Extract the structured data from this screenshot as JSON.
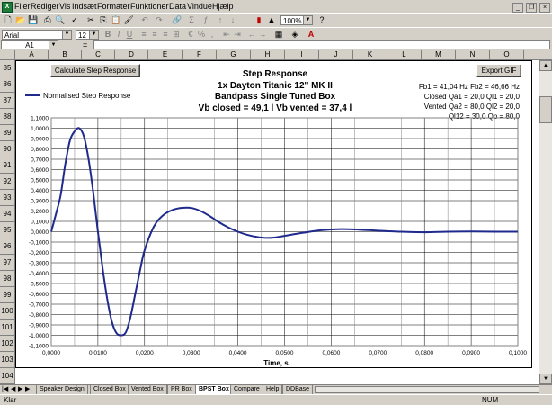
{
  "menu": {
    "items": [
      "Filer",
      "Rediger",
      "Vis",
      "Indsæt",
      "Formater",
      "Funktioner",
      "Data",
      "Vindue",
      "Hjælp"
    ]
  },
  "toolbar": {
    "zoom": "100%",
    "font_name": "Arial",
    "font_size": "12"
  },
  "formula_bar": {
    "name_box": "A1",
    "equals_sign": "="
  },
  "columns": [
    "A",
    "B",
    "C",
    "D",
    "E",
    "F",
    "G",
    "H",
    "I",
    "J",
    "K",
    "L",
    "M",
    "N",
    "O"
  ],
  "rows": [
    "85",
    "86",
    "87",
    "88",
    "89",
    "90",
    "91",
    "92",
    "93",
    "94",
    "95",
    "96",
    "97",
    "98",
    "99",
    "100",
    "101",
    "102",
    "103",
    "104"
  ],
  "buttons": {
    "calculate": "Calculate Step Response",
    "export": "Export GIF"
  },
  "chart_data": {
    "type": "line",
    "title": "Step Response",
    "subtitle_lines": [
      "1x Dayton Titanic 12'' MK II",
      "Bandpass Single Tuned Box",
      "Vb closed = 49,1 l    Vb vented = 37,4 l"
    ],
    "xlabel": "Time, s",
    "ylabel": "",
    "xlim": [
      0,
      0.1
    ],
    "ylim": [
      -1.1,
      1.1
    ],
    "xticks": [
      "0,0000",
      "0,0100",
      "0,0200",
      "0,0300",
      "0,0400",
      "0,0500",
      "0,0600",
      "0,0700",
      "0,0800",
      "0,0900",
      "0,1000"
    ],
    "yticks": [
      "1,1000",
      "1,0000",
      "0,9000",
      "0,8000",
      "0,7000",
      "0,6000",
      "0,5000",
      "0,4000",
      "0,3000",
      "0,2000",
      "0,1000",
      "0,0000",
      "-0,1000",
      "-0,2000",
      "-0,3000",
      "-0,4000",
      "-0,5000",
      "-0,6000",
      "-0,7000",
      "-0,8000",
      "-0,9000",
      "-1,0000",
      "-1,1000"
    ],
    "grid": true,
    "legend_position": "top-left",
    "series": [
      {
        "name": "Normalised Step Response",
        "color": "#1f2a8c",
        "x": [
          0,
          0.001,
          0.002,
          0.003,
          0.004,
          0.005,
          0.006,
          0.007,
          0.008,
          0.009,
          0.01,
          0.011,
          0.012,
          0.013,
          0.014,
          0.015,
          0.016,
          0.017,
          0.018,
          0.019,
          0.02,
          0.022,
          0.024,
          0.026,
          0.028,
          0.03,
          0.032,
          0.034,
          0.036,
          0.038,
          0.04,
          0.042,
          0.044,
          0.046,
          0.048,
          0.05,
          0.054,
          0.058,
          0.062,
          0.066,
          0.07,
          0.075,
          0.08,
          0.085,
          0.09,
          0.095,
          0.1
        ],
        "y": [
          0.0,
          0.17,
          0.35,
          0.65,
          0.88,
          0.97,
          1.0,
          0.92,
          0.7,
          0.38,
          0.0,
          -0.35,
          -0.65,
          -0.87,
          -0.98,
          -1.0,
          -0.97,
          -0.82,
          -0.6,
          -0.38,
          -0.18,
          0.05,
          0.16,
          0.21,
          0.23,
          0.23,
          0.2,
          0.15,
          0.09,
          0.04,
          0.0,
          -0.03,
          -0.05,
          -0.06,
          -0.055,
          -0.04,
          -0.01,
          0.015,
          0.025,
          0.02,
          0.01,
          0.0,
          -0.005,
          0.0,
          0.002,
          0.0,
          0.0
        ]
      }
    ],
    "annotations": [
      "Fb1 = 41,04 Hz  Fb2 = 46,66 Hz",
      "Closed Qa1 = 20,0  Ql1 = 20,0",
      "Vented Qa2 = 80,0  Ql2 = 20,0",
      "Ql12 = 30,0  Qp = 80,0"
    ]
  },
  "sheet_tabs": [
    "Speaker Design",
    "Closed Box",
    "Vented Box",
    "PR Box",
    "BPST Box",
    "Compare",
    "Help",
    "DDBase"
  ],
  "active_tab": "BPST Box",
  "status": {
    "left": "Klar",
    "right": "NUM"
  }
}
